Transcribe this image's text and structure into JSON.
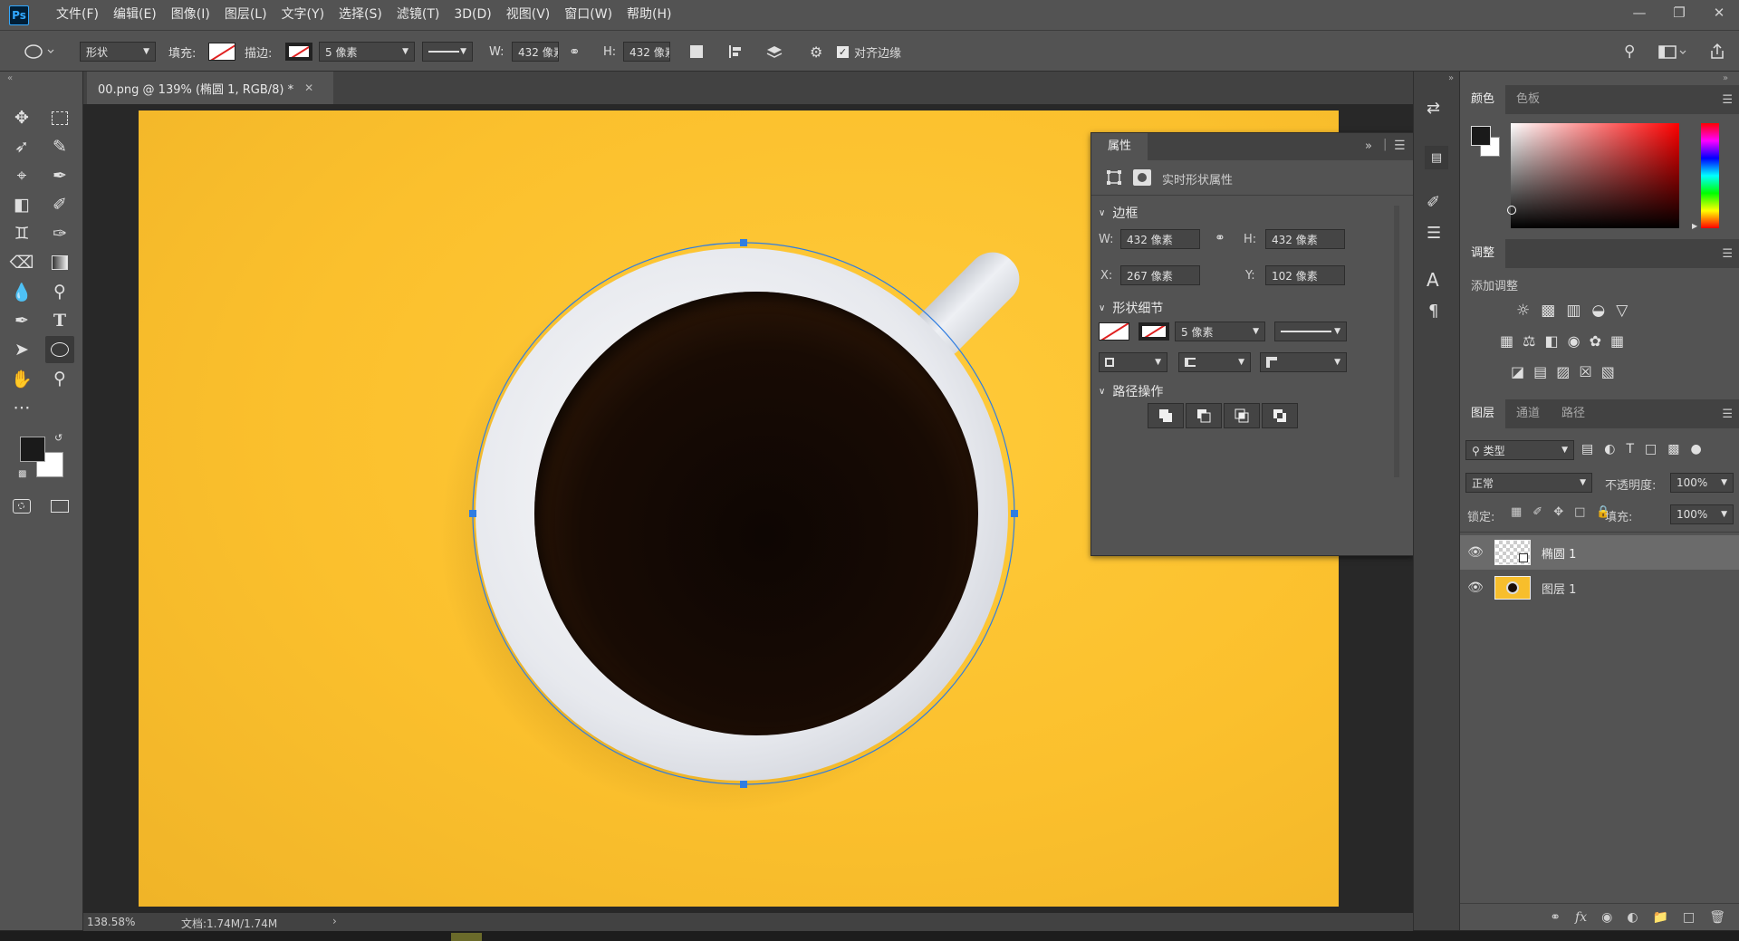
{
  "app": {
    "logo": "Ps"
  },
  "menu": [
    "文件(F)",
    "编辑(E)",
    "图像(I)",
    "图层(L)",
    "文字(Y)",
    "选择(S)",
    "滤镜(T)",
    "3D(D)",
    "视图(V)",
    "窗口(W)",
    "帮助(H)"
  ],
  "options": {
    "mode": "形状",
    "fill_label": "填充:",
    "stroke_label": "描边:",
    "stroke_width": "5 像素",
    "w_label": "W:",
    "w_value": "432 像素",
    "h_label": "H:",
    "h_value": "432 像素",
    "align_edges": "对齐边缘"
  },
  "document": {
    "tab_title": "00.png @ 139% (椭圆 1, RGB/8) *",
    "zoom": "138.58%",
    "doc_info": "文档:1.74M/1.74M"
  },
  "properties": {
    "title": "属性",
    "subtitle": "实时形状属性",
    "bbox_title": "边框",
    "w_label": "W:",
    "w": "432 像素",
    "h_label": "H:",
    "h": "432 像素",
    "x_label": "X:",
    "x": "267 像素",
    "y_label": "Y:",
    "y": "102 像素",
    "shape_detail_title": "形状细节",
    "stroke_width": "5 像素",
    "path_ops_title": "路径操作"
  },
  "color_panel": {
    "tabs": [
      "颜色",
      "色板"
    ],
    "accent": "#ff0000"
  },
  "adjust_panel": {
    "title": "调整",
    "add_label": "添加调整"
  },
  "layers_panel": {
    "tabs": [
      "图层",
      "通道",
      "路径"
    ],
    "filter_type": "类型",
    "blend_mode": "正常",
    "opacity_label": "不透明度:",
    "opacity": "100%",
    "lock_label": "锁定:",
    "fill_label": "填充:",
    "fill": "100%",
    "layers": [
      {
        "name": "椭圆 1",
        "selected": true
      },
      {
        "name": "图层 1",
        "selected": false
      }
    ]
  },
  "colors": {
    "canvas_yellow": "#fbc02d",
    "selection_blue": "#2f7de1"
  }
}
